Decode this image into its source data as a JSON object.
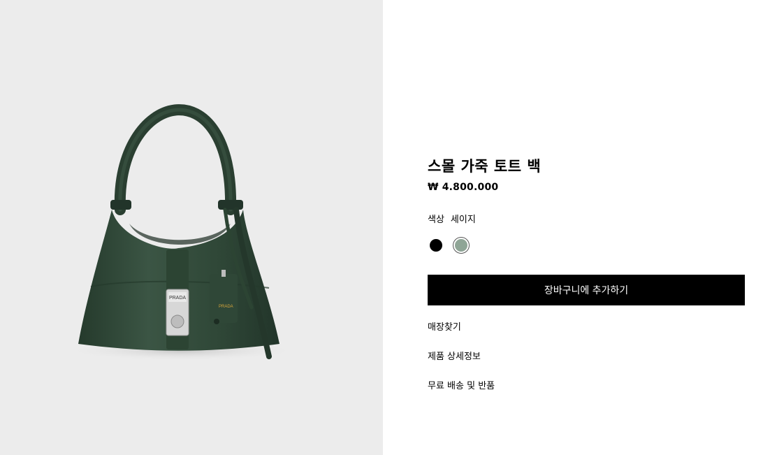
{
  "product": {
    "title": "스몰 가죽 토트 백",
    "price": "₩ 4.800.000",
    "image_brand_label": "PRADA",
    "image_logo_sub": "MILANO"
  },
  "color": {
    "label": "색상",
    "selected_name": "세이지",
    "swatches": [
      {
        "name": "black-swatch",
        "color": "#000000",
        "selected": false
      },
      {
        "name": "sage-swatch",
        "color": "#8fa596",
        "selected": true
      }
    ]
  },
  "actions": {
    "add_to_cart": "장바구니에 추가하기"
  },
  "links": {
    "find_store": "매장찾기",
    "product_details": "제품 상세정보",
    "shipping_returns": "무료 배송 및 반품"
  },
  "colors": {
    "image_background": "#ececec",
    "bag_green": "#2f4536",
    "button_background": "#000000"
  }
}
